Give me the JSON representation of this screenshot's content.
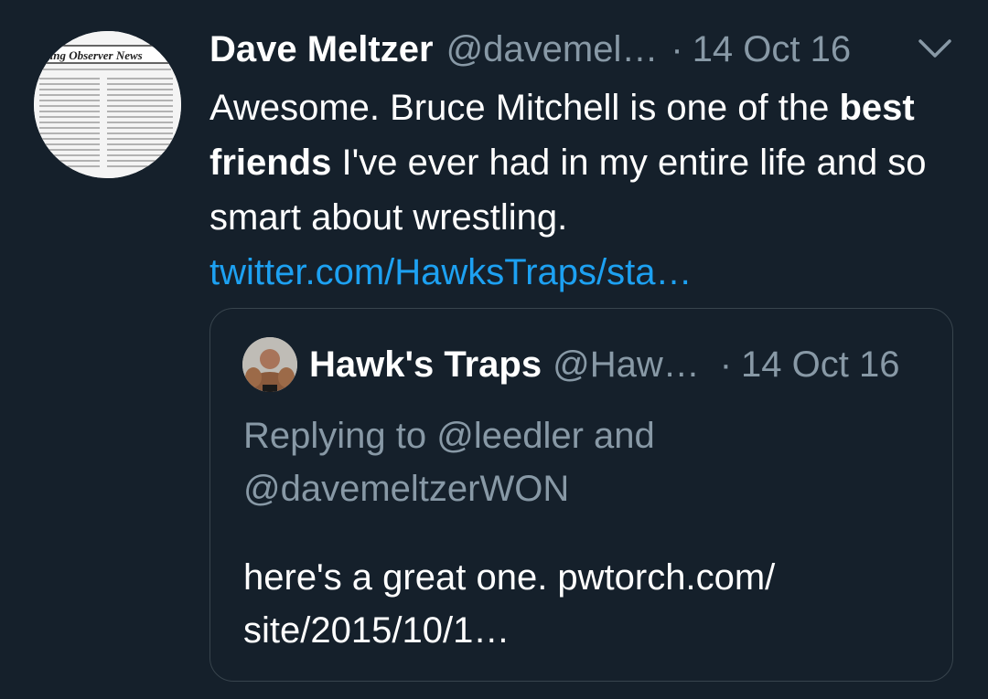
{
  "tweet": {
    "author_name": "Dave Meltzer",
    "handle": "@davemel…",
    "separator": "·",
    "date": "14 Oct 16",
    "text_part1": "Awesome.  Bruce Mitchell is one of the",
    "text_bold": "best friends",
    "text_part2": " I've ever had in my entire life and so smart about wrestling.",
    "link": "twitter.com/HawksTraps/sta…",
    "avatar_label": "ling Observer News"
  },
  "quoted": {
    "author_name": "Hawk's Traps",
    "handle": "@Haw…",
    "separator": "·",
    "date": "14 Oct 16",
    "replying_line1": "Replying to @leedler and",
    "replying_line2": "@davemeltzerWON",
    "text_line1": "here's a great one. pwtorch.com/",
    "text_line2": "site/2015/10/1…"
  },
  "icons": {
    "menu": "chevron-down-icon"
  },
  "colors": {
    "background": "#15202b",
    "secondary_text": "#8899a6",
    "link": "#1da1f2",
    "border": "#38444d"
  }
}
